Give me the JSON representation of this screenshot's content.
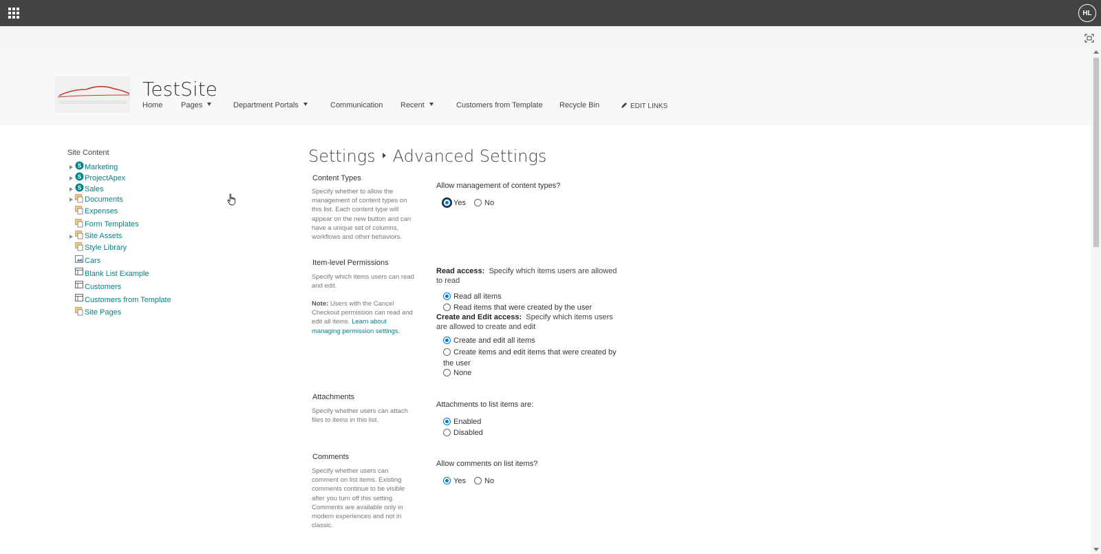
{
  "suite_bar": {
    "app_launcher_icon": "waffle-icon",
    "user_initials": "HL"
  },
  "site": {
    "title": "TestSite"
  },
  "top_nav": [
    {
      "label": "Home",
      "has_dropdown": false
    },
    {
      "label": "Pages",
      "has_dropdown": true
    },
    {
      "label": "Department Portals",
      "has_dropdown": true
    },
    {
      "label": "Communication",
      "has_dropdown": false
    },
    {
      "label": "Recent",
      "has_dropdown": true
    },
    {
      "label": "Customers from Template",
      "has_dropdown": false
    },
    {
      "label": "Recycle Bin",
      "has_dropdown": false
    }
  ],
  "edit_links": "EDIT LINKS",
  "tree": {
    "title": "Site Content",
    "items": [
      {
        "label": "Marketing",
        "icon": "subsite-icon",
        "expandable": true
      },
      {
        "label": "ProjectApex",
        "icon": "subsite-icon",
        "expandable": true
      },
      {
        "label": "Sales",
        "icon": "subsite-icon",
        "expandable": true
      },
      {
        "label": "Documents",
        "icon": "document-library-icon",
        "expandable": true
      },
      {
        "label": "Expenses",
        "icon": "document-library-icon",
        "expandable": false
      },
      {
        "label": "Form Templates",
        "icon": "document-library-icon",
        "expandable": false
      },
      {
        "label": "Site Assets",
        "icon": "document-library-icon",
        "expandable": true
      },
      {
        "label": "Style Library",
        "icon": "document-library-icon",
        "expandable": false
      },
      {
        "label": "Cars",
        "icon": "picture-library-icon",
        "expandable": false
      },
      {
        "label": "Blank List Example",
        "icon": "list-icon",
        "expandable": false
      },
      {
        "label": "Customers",
        "icon": "list-icon",
        "expandable": false
      },
      {
        "label": "Customers from Template",
        "icon": "list-icon",
        "expandable": false
      },
      {
        "label": "Site Pages",
        "icon": "document-library-icon",
        "expandable": false
      }
    ]
  },
  "breadcrumb": {
    "parent": "Settings",
    "current": "Advanced Settings"
  },
  "sections": {
    "content_types": {
      "title": "Content Types",
      "description": "Specify whether to allow the management of content types on this list. Each content type will appear on the new button and can have a unique set of columns, workflows and other behaviors.",
      "question": "Allow management of content types?",
      "options": [
        "Yes",
        "No"
      ],
      "selected": "Yes"
    },
    "item_permissions": {
      "title": "Item-level Permissions",
      "description": "Specify which items users can read and edit.",
      "note_label": "Note:",
      "note_text": "Users with the Cancel Checkout permission can read and edit all items.",
      "note_link": "Learn about managing permission settings.",
      "read_label": "Read access:",
      "read_text": "Specify which items users are allowed to read",
      "read_options": [
        "Read all items",
        "Read items that were created by the user"
      ],
      "read_selected": "Read all items",
      "edit_label": "Create and Edit access:",
      "edit_text": "Specify which items users are allowed to create and edit",
      "edit_options": [
        "Create and edit all items",
        "Create items and edit items that were created by the user",
        "None"
      ],
      "edit_selected": "Create and edit all items"
    },
    "attachments": {
      "title": "Attachments",
      "description": "Specify whether users can attach files to items in this list.",
      "question": "Attachments to list items are:",
      "options": [
        "Enabled",
        "Disabled"
      ],
      "selected": "Enabled"
    },
    "comments": {
      "title": "Comments",
      "description": "Specify whether users can comment on list items. Existing comments continue to be visible after you turn off this setting. Comments are available only in modern experiences and not in classic.",
      "question": "Allow comments on list items?",
      "options": [
        "Yes",
        "No"
      ],
      "selected": "Yes"
    }
  },
  "colors": {
    "accent": "#0078d4",
    "link": "#038387",
    "suite_bar": "#434343"
  }
}
